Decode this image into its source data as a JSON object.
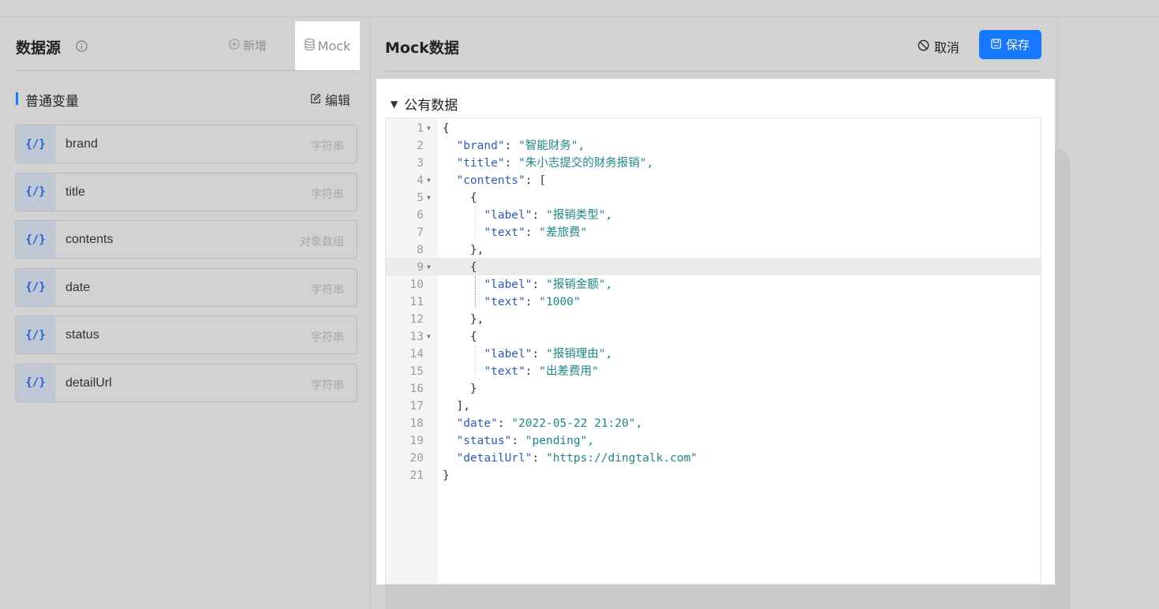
{
  "data_source": {
    "title": "数据源",
    "add_label": "新增",
    "mock_label": "Mock"
  },
  "section": {
    "label": "普通变量",
    "edit_label": "编辑"
  },
  "variables": [
    {
      "icon_text": "{/}",
      "name": "brand",
      "type": "字符串"
    },
    {
      "icon_text": "{/}",
      "name": "title",
      "type": "字符串"
    },
    {
      "icon_text": "{/}",
      "name": "contents",
      "type": "对象数组"
    },
    {
      "icon_text": "{/}",
      "name": "date",
      "type": "字符串"
    },
    {
      "icon_text": "{/}",
      "name": "status",
      "type": "字符串"
    },
    {
      "icon_text": "{/}",
      "name": "detailUrl",
      "type": "字符串"
    }
  ],
  "mock_panel": {
    "title": "Mock数据",
    "cancel_label": "取消",
    "save_label": "保存",
    "public_data_label": "公有数据"
  },
  "code_lines": [
    {
      "num": "1",
      "fold": true,
      "text": "{"
    },
    {
      "num": "2",
      "fold": false,
      "key": "\"brand\"",
      "value": "\"智能财务\",",
      "indent": "  "
    },
    {
      "num": "3",
      "fold": false,
      "key": "\"title\"",
      "value": "\"朱小志提交的财务报销\",",
      "indent": "  "
    },
    {
      "num": "4",
      "fold": true,
      "key": "\"contents\"",
      "value": "[",
      "indent": "  "
    },
    {
      "num": "5",
      "fold": true,
      "text": "    {"
    },
    {
      "num": "6",
      "fold": false,
      "key": "\"label\"",
      "value": "\"报销类型\",",
      "indent": "      "
    },
    {
      "num": "7",
      "fold": false,
      "key": "\"text\"",
      "value": "\"差旅费\"",
      "indent": "      "
    },
    {
      "num": "8",
      "fold": false,
      "text": "    },"
    },
    {
      "num": "9",
      "fold": true,
      "text": "    {"
    },
    {
      "num": "10",
      "fold": false,
      "key": "\"label\"",
      "value": "\"报销金额\",",
      "indent": "      "
    },
    {
      "num": "11",
      "fold": false,
      "key": "\"text\"",
      "value": "\"1000\"",
      "indent": "      "
    },
    {
      "num": "12",
      "fold": false,
      "text": "    },"
    },
    {
      "num": "13",
      "fold": true,
      "text": "    {"
    },
    {
      "num": "14",
      "fold": false,
      "key": "\"label\"",
      "value": "\"报销理由\",",
      "indent": "      "
    },
    {
      "num": "15",
      "fold": false,
      "key": "\"text\"",
      "value": "\"出差费用\"",
      "indent": "      "
    },
    {
      "num": "16",
      "fold": false,
      "text": "    }"
    },
    {
      "num": "17",
      "fold": false,
      "text": "  ],"
    },
    {
      "num": "18",
      "fold": false,
      "key": "\"date\"",
      "value": "\"2022-05-22 21:20\",",
      "indent": "  "
    },
    {
      "num": "19",
      "fold": false,
      "key": "\"status\"",
      "value": "\"pending\",",
      "indent": "  "
    },
    {
      "num": "20",
      "fold": false,
      "key": "\"detailUrl\"",
      "value": "\"https://dingtalk.com\"",
      "indent": "  "
    },
    {
      "num": "21",
      "fold": false,
      "text": "}"
    }
  ],
  "colors": {
    "accent": "#1677ff",
    "key": "#2a59c8",
    "string": "#1b8a86"
  }
}
